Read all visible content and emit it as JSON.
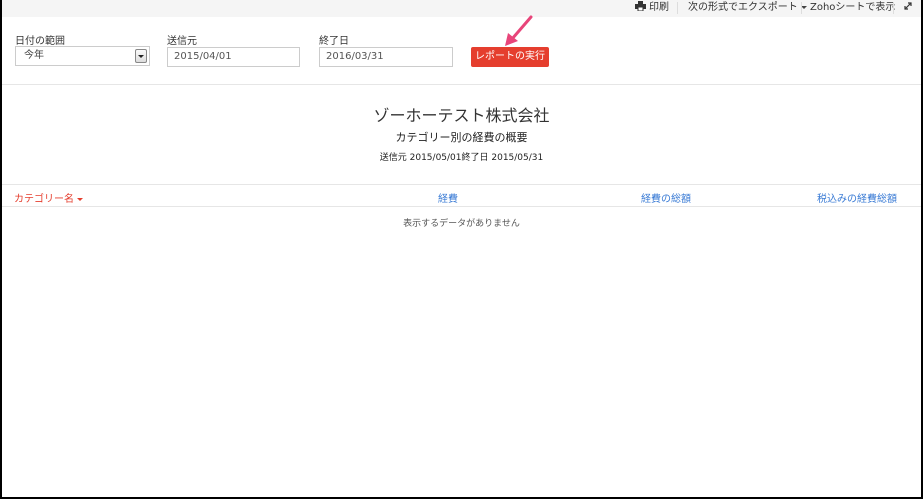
{
  "toolbar": {
    "print": "印刷",
    "export": "次の形式でエクスポート",
    "zoho_sheet": "Zohoシートで表示"
  },
  "filters": {
    "date_range_label": "日付の範囲",
    "date_range_value": "今年",
    "from_label": "送信元",
    "from_value": "2015/04/01",
    "to_label": "終了日",
    "to_value": "2016/03/31",
    "run_button": "レポートの実行"
  },
  "report": {
    "company": "ゾーホーテスト株式会社",
    "title": "カテゴリー別の経費の概要",
    "date_range": "送信元 2015/05/01終了日 2015/05/31"
  },
  "table": {
    "columns": [
      "カテゴリー名",
      "経費",
      "経費の総額",
      "税込みの経費総額"
    ],
    "empty_message": "表示するデータがありません"
  },
  "colors": {
    "accent": "#e53e2e",
    "link": "#3a7bd5"
  }
}
